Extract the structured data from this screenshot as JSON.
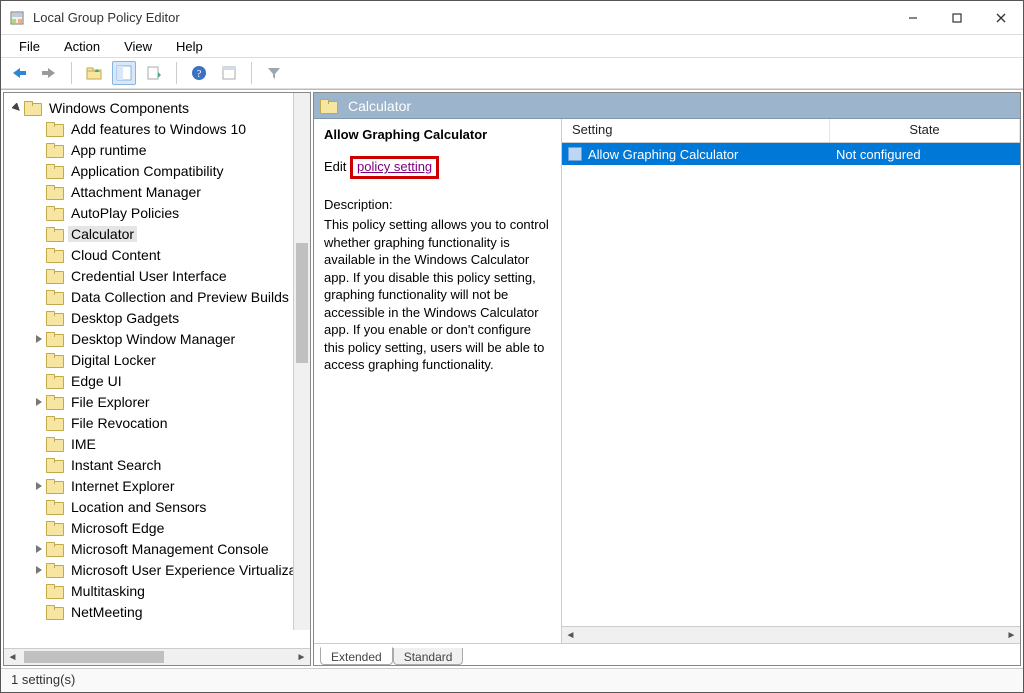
{
  "window": {
    "title": "Local Group Policy Editor"
  },
  "menu": {
    "file": "File",
    "action": "Action",
    "view": "View",
    "help": "Help"
  },
  "tree": {
    "root": "Windows Components",
    "items": [
      {
        "label": "Add features to Windows 10",
        "expander": ""
      },
      {
        "label": "App runtime",
        "expander": ""
      },
      {
        "label": "Application Compatibility",
        "expander": ""
      },
      {
        "label": "Attachment Manager",
        "expander": ""
      },
      {
        "label": "AutoPlay Policies",
        "expander": ""
      },
      {
        "label": "Calculator",
        "expander": "",
        "selected": true
      },
      {
        "label": "Cloud Content",
        "expander": ""
      },
      {
        "label": "Credential User Interface",
        "expander": ""
      },
      {
        "label": "Data Collection and Preview Builds",
        "expander": ""
      },
      {
        "label": "Desktop Gadgets",
        "expander": ""
      },
      {
        "label": "Desktop Window Manager",
        "expander": ">"
      },
      {
        "label": "Digital Locker",
        "expander": ""
      },
      {
        "label": "Edge UI",
        "expander": ""
      },
      {
        "label": "File Explorer",
        "expander": ">"
      },
      {
        "label": "File Revocation",
        "expander": ""
      },
      {
        "label": "IME",
        "expander": ""
      },
      {
        "label": "Instant Search",
        "expander": ""
      },
      {
        "label": "Internet Explorer",
        "expander": ">"
      },
      {
        "label": "Location and Sensors",
        "expander": ""
      },
      {
        "label": "Microsoft Edge",
        "expander": ""
      },
      {
        "label": "Microsoft Management Console",
        "expander": ">"
      },
      {
        "label": "Microsoft User Experience Virtualiza",
        "expander": ">"
      },
      {
        "label": "Multitasking",
        "expander": ""
      },
      {
        "label": "NetMeeting",
        "expander": ""
      }
    ]
  },
  "right": {
    "header": "Calculator",
    "detail": {
      "title": "Allow Graphing Calculator",
      "edit_prefix": "Edit ",
      "edit_link": "policy setting",
      "desc_label": "Description:",
      "description": "This policy setting allows you to control whether graphing functionality is available in the Windows Calculator app. If you disable this policy setting, graphing functionality will not be accessible in the Windows Calculator app. If you enable or don't configure this policy setting, users will be able to access graphing functionality."
    },
    "list": {
      "col_setting": "Setting",
      "col_state": "State",
      "rows": [
        {
          "setting": "Allow Graphing Calculator",
          "state": "Not configured"
        }
      ]
    },
    "tabs": {
      "extended": "Extended",
      "standard": "Standard"
    }
  },
  "status": {
    "text": "1 setting(s)"
  }
}
